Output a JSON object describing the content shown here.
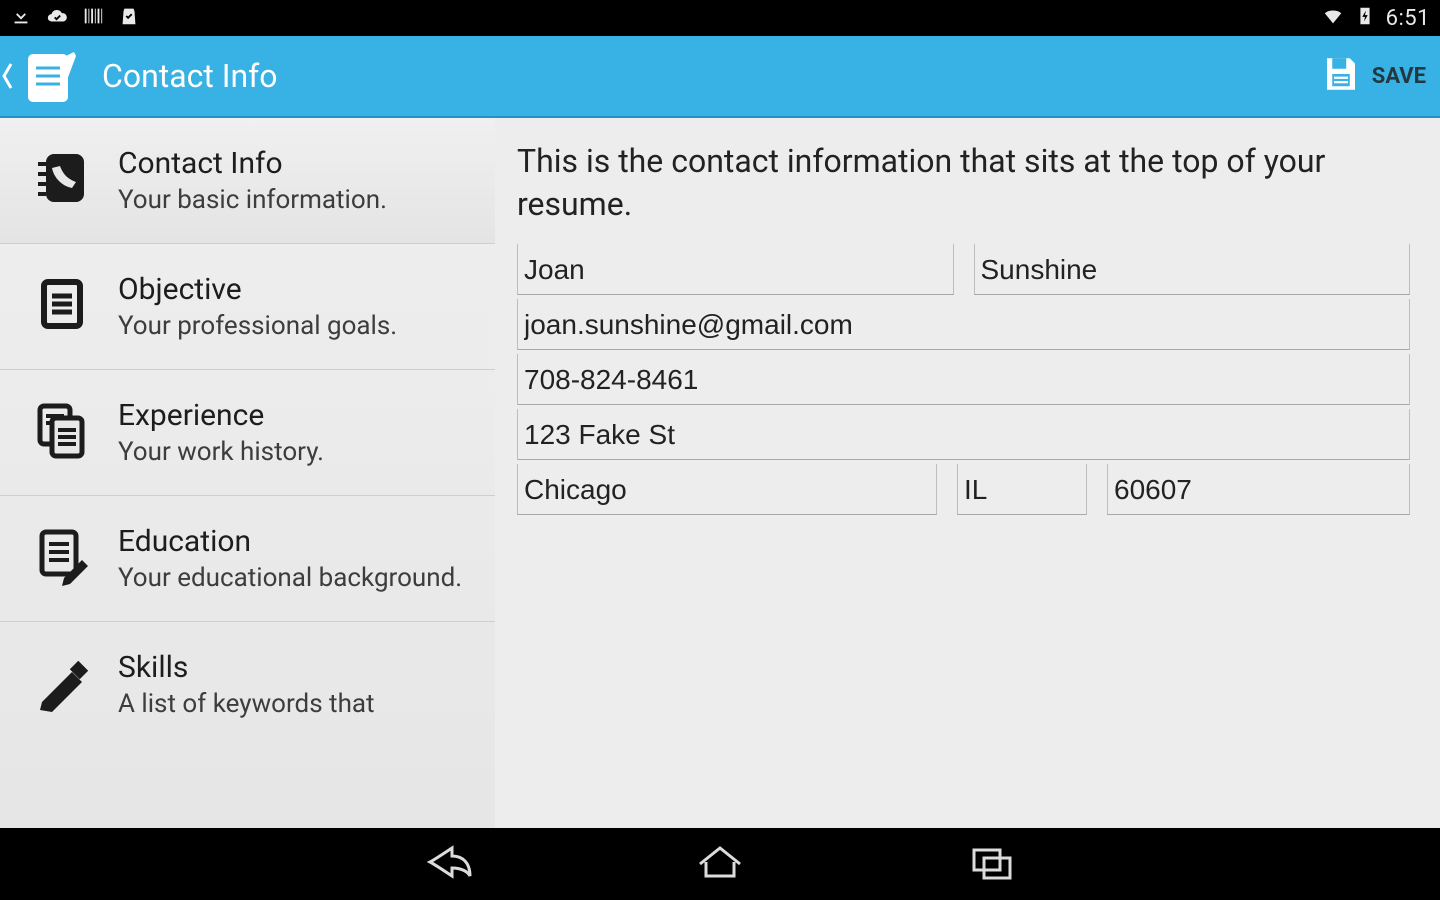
{
  "statusbar": {
    "time": "6:51"
  },
  "appbar": {
    "title": "Contact Info",
    "save_label": "SAVE"
  },
  "sidebar": {
    "items": [
      {
        "title": "Contact Info",
        "subtitle": "Your basic information."
      },
      {
        "title": "Objective",
        "subtitle": "Your professional goals."
      },
      {
        "title": "Experience",
        "subtitle": "Your work history."
      },
      {
        "title": "Education",
        "subtitle": "Your educational background."
      },
      {
        "title": "Skills",
        "subtitle": "A list of keywords that"
      }
    ]
  },
  "content": {
    "intro": "This is the contact information that sits at the top of your resume.",
    "first_name": "Joan",
    "last_name": "Sunshine",
    "email": "joan.sunshine@gmail.com",
    "phone": "708-824-8461",
    "address": "123 Fake St",
    "city": "Chicago",
    "state": "IL",
    "zip": "60607"
  }
}
